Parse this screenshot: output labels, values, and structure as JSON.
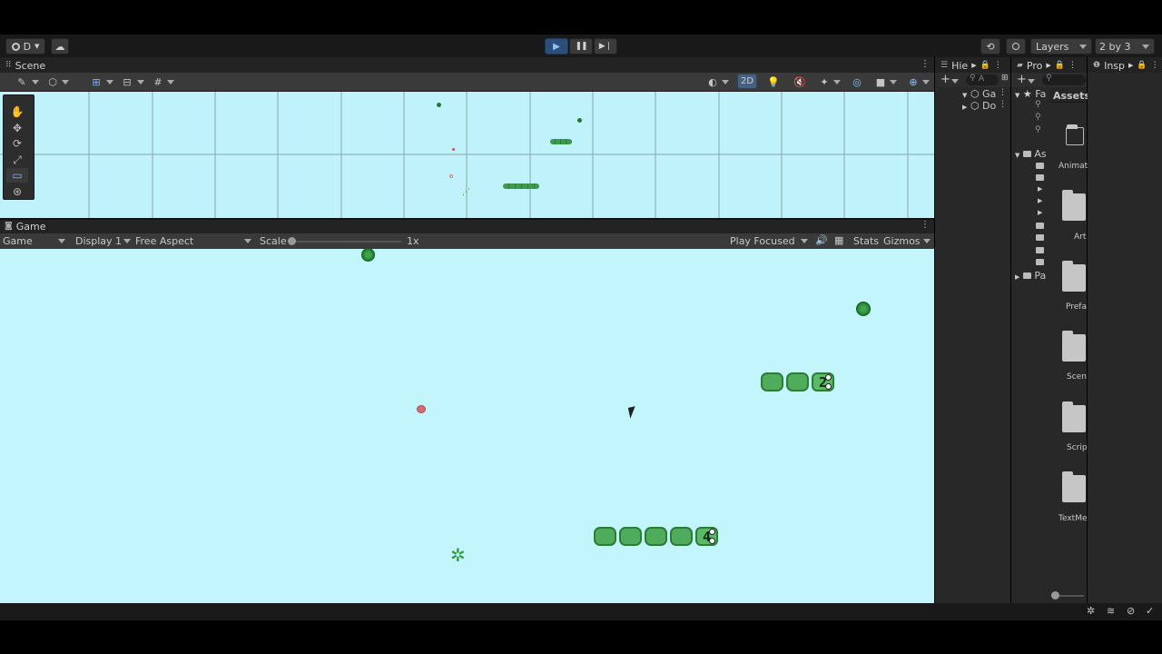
{
  "toolbar": {
    "account_label": "D",
    "layers_label": "Layers",
    "layout_label": "2 by 3"
  },
  "scene": {
    "tab_label": "Scene",
    "mode_2d": "2D"
  },
  "game": {
    "tab_label": "Game",
    "view_select": "Game",
    "display_select": "Display 1",
    "aspect_select": "Free Aspect",
    "scale_label": "Scale",
    "scale_value": "1x",
    "play_mode": "Play Focused",
    "stats_label": "Stats",
    "gizmos_label": "Gizmos",
    "snake_numbers": [
      "2",
      "4"
    ]
  },
  "hierarchy": {
    "tab_label": "Hie",
    "search_placeholder": "A",
    "items": [
      "Ga",
      "Do"
    ]
  },
  "project": {
    "tab_label": "Pro",
    "favorites_label": "Fa",
    "assets_root_label": "As",
    "packages_label": "Pa",
    "breadcrumb": "Assets",
    "folders": [
      "Animat",
      "Art",
      "Prefa",
      "Scen",
      "Scrip",
      "TextMe"
    ]
  },
  "inspector": {
    "tab_label": "Insp"
  },
  "colors": {
    "scene_bg": "#bff2fb",
    "game_bg": "#c2f5fc",
    "snake_green": "#4fac5c",
    "accent_blue": "#3b79c8"
  }
}
